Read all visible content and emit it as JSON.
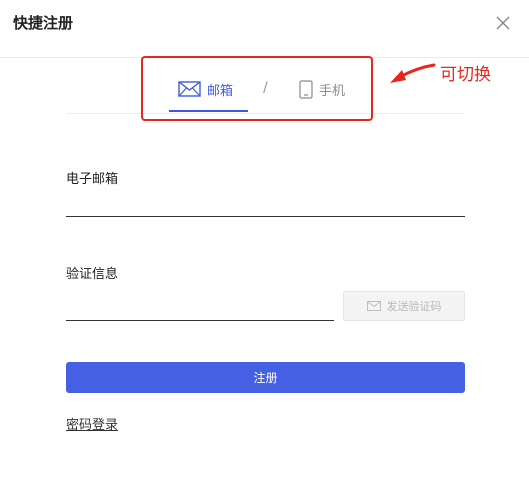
{
  "dialog": {
    "title": "快捷注册"
  },
  "tabs": {
    "email_label": "邮箱",
    "separator": "/",
    "phone_label": "手机",
    "active": "email"
  },
  "annotation": {
    "text": "可切换"
  },
  "form": {
    "email_label": "电子邮箱",
    "email_value": "",
    "code_label": "验证信息",
    "code_value": "",
    "send_code_label": "发送验证码"
  },
  "register_label": "注册",
  "password_login_label": "密码登录",
  "colors": {
    "accent": "#4560e2",
    "annotation": "#e8261e",
    "disabled": "#b8b8b8"
  }
}
